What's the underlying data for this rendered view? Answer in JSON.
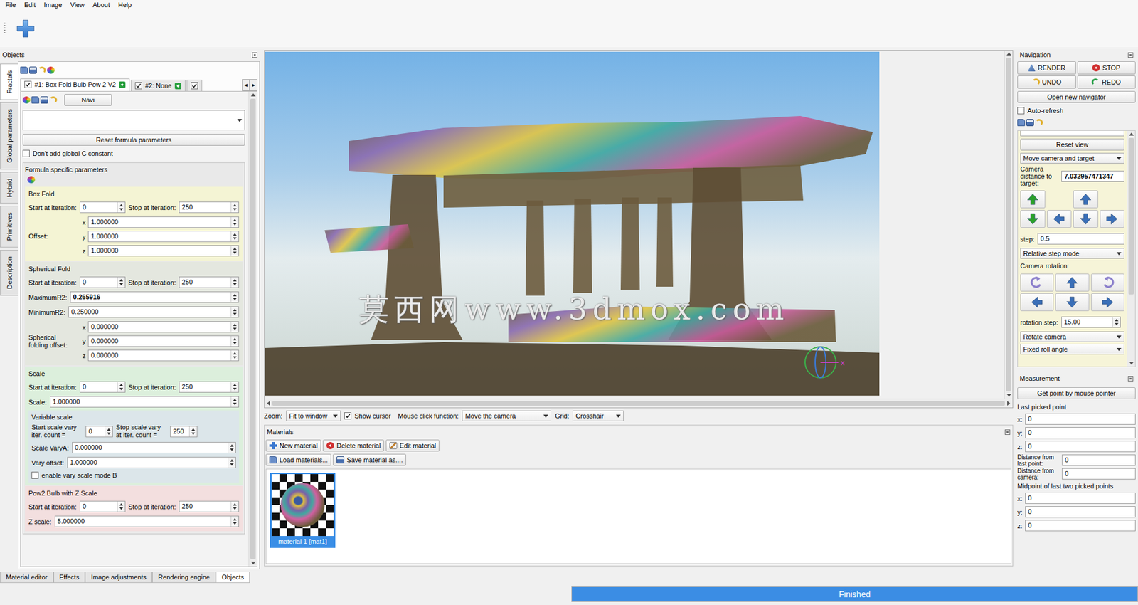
{
  "menu": [
    "File",
    "Edit",
    "Image",
    "View",
    "About",
    "Help"
  ],
  "objects": {
    "title": "Objects",
    "side_tabs": [
      {
        "label": "Fractals",
        "selected": true
      },
      {
        "label": "Global parameters",
        "selected": false
      },
      {
        "label": "Hybrid",
        "selected": false
      },
      {
        "label": "Primitives",
        "selected": false
      },
      {
        "label": "Description",
        "selected": false
      }
    ],
    "fractal_tabs": [
      {
        "label": "#1: Box Fold Bulb Pow 2 V2",
        "checked": true,
        "selected": true
      },
      {
        "label": "#2: None",
        "checked": true,
        "selected": false
      },
      {
        "label": "",
        "checked": true,
        "selected": false
      }
    ],
    "tab_arrows": [
      "◂",
      "▸"
    ],
    "navi": "Navi",
    "formula": "",
    "reset": "Reset formula parameters",
    "global_c": {
      "label": "Don't add global C constant",
      "checked": false
    },
    "group_title": "Formula specific parameters",
    "sections": [
      {
        "title": "Box Fold",
        "color": "#f4f4d4",
        "rows": [
          {
            "kind": "pair",
            "items": [
              {
                "label": "Start at iteration:",
                "value": "0"
              },
              {
                "label": "Stop at iteration:",
                "value": "250"
              }
            ]
          },
          {
            "kind": "vector",
            "label": "Offset:",
            "axes": [
              {
                "axis": "x",
                "value": "1.000000"
              },
              {
                "axis": "y",
                "value": "1.000000"
              },
              {
                "axis": "z",
                "value": "1.000000"
              }
            ]
          }
        ]
      },
      {
        "title": "Spherical Fold",
        "color": "#e4e7df",
        "rows": [
          {
            "kind": "pair",
            "items": [
              {
                "label": "Start at iteration:",
                "value": "0"
              },
              {
                "label": "Stop at iteration:",
                "value": "250"
              }
            ]
          },
          {
            "kind": "field",
            "label": "MaximumR2:",
            "value": "0.265916",
            "bold": true
          },
          {
            "kind": "field",
            "label": "MinimumR2:",
            "value": "0.250000",
            "bold": false
          },
          {
            "kind": "vector",
            "label": "Spherical folding offset:",
            "axes": [
              {
                "axis": "x",
                "value": "0.000000"
              },
              {
                "axis": "y",
                "value": "0.000000"
              },
              {
                "axis": "z",
                "value": "0.000000"
              }
            ]
          }
        ]
      },
      {
        "title": "Scale",
        "color": "#dcefdc",
        "rows": [
          {
            "kind": "pair",
            "items": [
              {
                "label": "Start at iteration:",
                "value": "0"
              },
              {
                "label": "Stop at iteration:",
                "value": "250"
              }
            ]
          },
          {
            "kind": "field",
            "label": "Scale:",
            "value": "1.000000",
            "bold": false
          },
          {
            "kind": "group",
            "title": "Variable scale",
            "color": "#dce6ea",
            "rows": [
              {
                "kind": "pair",
                "items": [
                  {
                    "label": "Start scale vary iter. count =",
                    "value": "0"
                  },
                  {
                    "label": "Stop scale vary at iter. count =",
                    "value": "250"
                  }
                ]
              },
              {
                "kind": "field",
                "label": "Scale VaryA:",
                "value": "0.000000",
                "bold": false
              },
              {
                "kind": "field",
                "label": "Vary offset:",
                "value": "1.000000",
                "bold": false
              },
              {
                "kind": "checkbox",
                "label": "enable vary scale mode B",
                "checked": false
              }
            ]
          }
        ]
      },
      {
        "title": "Pow2 Bulb with Z Scale",
        "color": "#f3dfdf",
        "rows": [
          {
            "kind": "pair",
            "items": [
              {
                "label": "Start at iteration:",
                "value": "0"
              },
              {
                "label": "Stop at iteration:",
                "value": "250"
              }
            ]
          },
          {
            "kind": "field",
            "label": "Z scale:",
            "value": "5.000000",
            "bold": false
          }
        ]
      }
    ],
    "bottom_tabs": [
      {
        "label": "Material editor",
        "selected": false
      },
      {
        "label": "Effects",
        "selected": false
      },
      {
        "label": "Image adjustments",
        "selected": false
      },
      {
        "label": "Rendering engine",
        "selected": false
      },
      {
        "label": "Objects",
        "selected": true
      }
    ]
  },
  "viewport": {
    "watermark": "莫西网www.3dmox.com",
    "axis_label": "x"
  },
  "view_bar": {
    "zoom_label": "Zoom:",
    "zoom": "Fit to window",
    "show_cursor": {
      "label": "Show cursor",
      "checked": true
    },
    "mouse_label": "Mouse click function:",
    "mouse": "Move the camera",
    "grid_label": "Grid:",
    "grid": "Crosshair"
  },
  "materials": {
    "title": "Materials",
    "button_rows": [
      [
        "New material",
        "Delete material",
        "Edit material"
      ],
      [
        "Load materials...",
        "Save material as...."
      ]
    ],
    "items": [
      {
        "label": "material 1 [mat1]",
        "selected": true
      }
    ]
  },
  "navigation": {
    "title": "Navigation",
    "render": "RENDER",
    "stop": "STOP",
    "undo": "UNDO",
    "redo": "REDO",
    "open_navigator": "Open new navigator",
    "auto_refresh": {
      "label": "Auto-refresh",
      "checked": false
    },
    "reset_view": "Reset view",
    "move_mode": "Move camera and target",
    "distance_label": "Camera distance to target:",
    "distance": "7.032957471347",
    "step_label": "step:",
    "step": "0.5",
    "step_mode": "Relative step mode",
    "rotation_title": "Camera rotation:",
    "rotation_step_label": "rotation step:",
    "rotation_step": "15.00",
    "rotation_mode": "Rotate camera",
    "roll_mode": "Fixed roll angle"
  },
  "measurement": {
    "title": "Measurement",
    "button": "Get point by mouse pointer",
    "last_title": "Last picked point",
    "last": [
      {
        "axis": "x:",
        "value": "0"
      },
      {
        "axis": "y:",
        "value": "0"
      },
      {
        "axis": "z:",
        "value": "0"
      }
    ],
    "distances": [
      {
        "label": "Distance from last point:",
        "value": "0"
      },
      {
        "label": "Distance from camera:",
        "value": "0"
      }
    ],
    "mid_title": "Midpoint of last two picked points",
    "mid": [
      {
        "axis": "x:",
        "value": "0"
      },
      {
        "axis": "y:",
        "value": "0"
      },
      {
        "axis": "z:",
        "value": "0"
      }
    ]
  },
  "status": {
    "text": "Finished",
    "level": 1
  }
}
